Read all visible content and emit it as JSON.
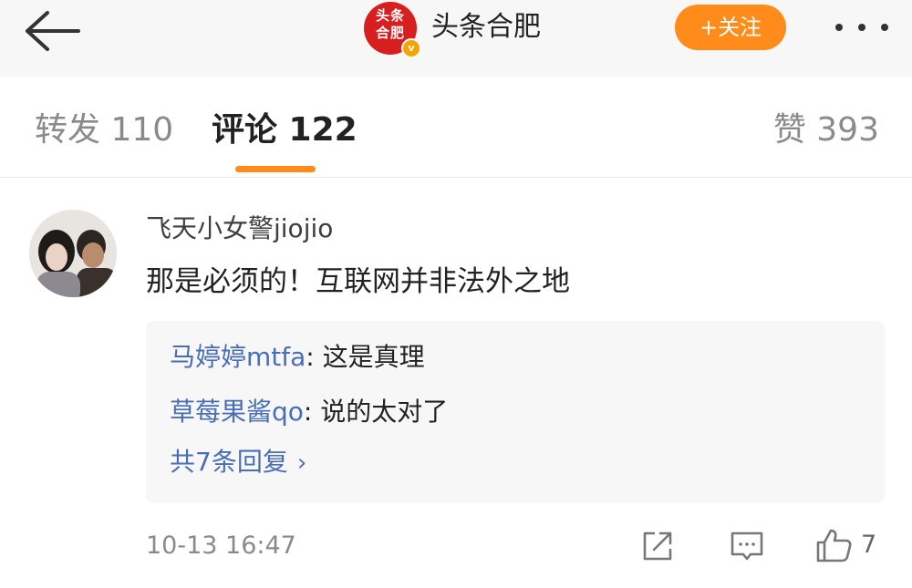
{
  "header": {
    "logo_text": "头条\n合肥",
    "account_name": "头条合肥",
    "follow_label": "+关注"
  },
  "tabs": {
    "repost": "转发 110",
    "comments": "评论 122",
    "likes": "赞 393"
  },
  "comment": {
    "user": "飞天小女警jiojio",
    "text": "那是必须的！互联网并非法外之地",
    "replies": [
      {
        "user": "马婷婷mtfa",
        "text": ": 这是真理"
      },
      {
        "user": "草莓果酱qo",
        "text": ": 说的太对了"
      }
    ],
    "all_replies": "共7条回复",
    "timestamp": "10-13 16:47",
    "like_count": "7"
  },
  "colors": {
    "accent": "#ff8c1a",
    "link": "#4a6eb5",
    "logo_red": "#d71f1f"
  }
}
